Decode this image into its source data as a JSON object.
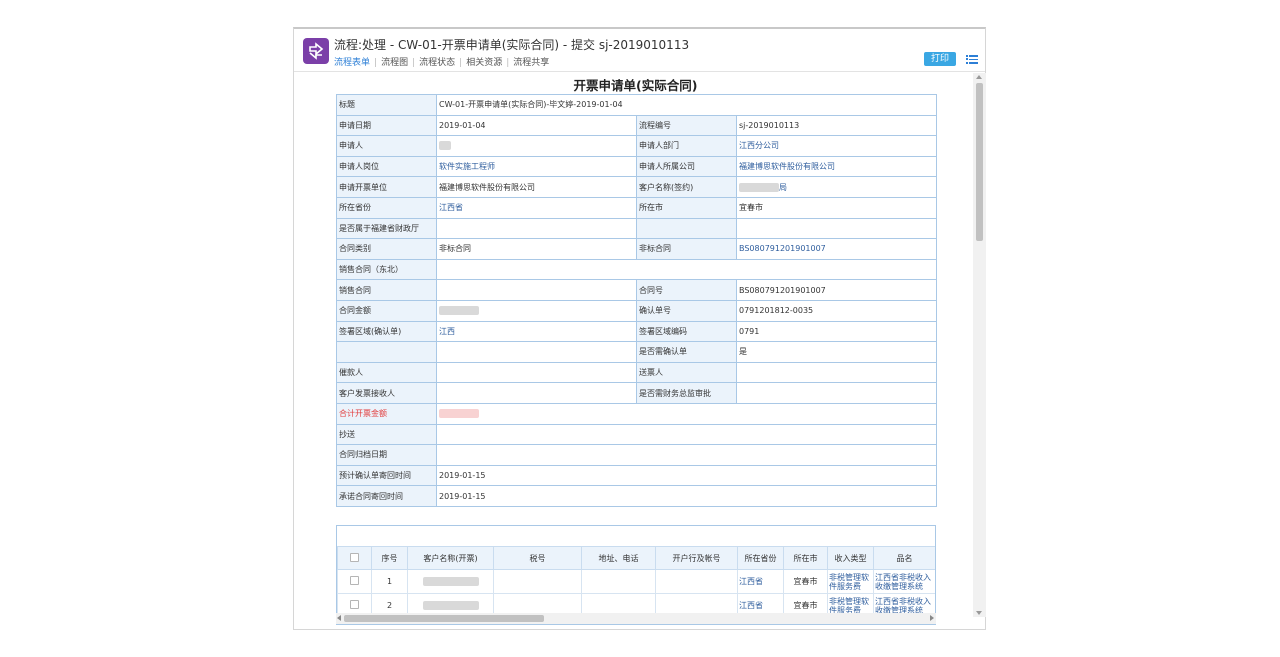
{
  "header": {
    "title": "流程:处理 - CW-01-开票申请单(实际合同) - 提交 sj-2019010113",
    "tabs": [
      "流程表单",
      "流程图",
      "流程状态",
      "相关资源",
      "流程共享"
    ],
    "print_label": "打印"
  },
  "form": {
    "title": "开票申请单(实际合同)",
    "subject_label": "标题",
    "subject_value": "CW-01-开票申请单(实际合同)-毕文婷-2019-01-04",
    "rows": [
      {
        "l1": "申请日期",
        "v1": "2019-01-04",
        "l2": "流程编号",
        "v2": "sj-2019010113"
      },
      {
        "l1": "申请人",
        "v1": "",
        "l2": "申请人部门",
        "v2": "江西分公司"
      },
      {
        "l1": "申请人岗位",
        "v1": "软件实施工程师",
        "l2": "申请人所属公司",
        "v2": "福建博思软件股份有限公司"
      },
      {
        "l1": "申请开票单位",
        "v1": "福建博思软件股份有限公司",
        "l2": "客户名称(签约)",
        "v2": "局"
      },
      {
        "l1": "所在省份",
        "v1": "江西省",
        "l2": "所在市",
        "v2": "宜春市"
      },
      {
        "l1": "是否属于福建省财政厅",
        "v1": "",
        "l2": "",
        "v2": ""
      },
      {
        "l1": "合同类别",
        "v1": "非标合同",
        "l2": "非标合同",
        "v2": "BS080791201901007"
      }
    ],
    "sales_dongbei_label": "销售合同（东北）",
    "rows2": [
      {
        "l1": "销售合同",
        "v1": "",
        "l2": "合同号",
        "v2": "BS080791201901007"
      },
      {
        "l1": "合同金额",
        "v1": "",
        "l2": "确认单号",
        "v2": "0791201812-0035"
      },
      {
        "l1": "签署区域(确认单)",
        "v1": "江西",
        "l2": "签署区域编码",
        "v2": "0791"
      },
      {
        "l1": "",
        "v1": "",
        "l2": "是否需确认单",
        "v2": "是"
      },
      {
        "l1": "催款人",
        "v1": "",
        "l2": "送票人",
        "v2": ""
      },
      {
        "l1": "客户发票接收人",
        "v1": "",
        "l2": "是否需财务总监审批",
        "v2": ""
      }
    ],
    "total_label": "合计开票金额",
    "cc_label": "抄送",
    "archive_label": "合同归档日期",
    "confirm_return_label": "预计确认单寄回时间",
    "confirm_return_value": "2019-01-15",
    "contract_return_label": "承诺合同寄回时间",
    "contract_return_value": "2019-01-15"
  },
  "detail": {
    "columns": [
      "序号",
      "客户名称(开票)",
      "税号",
      "地址、电话",
      "开户行及帐号",
      "所在省份",
      "所在市",
      "收入类型",
      "品名"
    ],
    "rows": [
      {
        "no": "1",
        "province": "江西省",
        "city": "宜春市",
        "income": "非税管理软件服务费",
        "product": "江西省非税收入收缴管理系统"
      },
      {
        "no": "2",
        "province": "江西省",
        "city": "宜春市",
        "income": "非税管理软件服务费",
        "product": "江西省非税收入收缴管理系统"
      }
    ]
  }
}
